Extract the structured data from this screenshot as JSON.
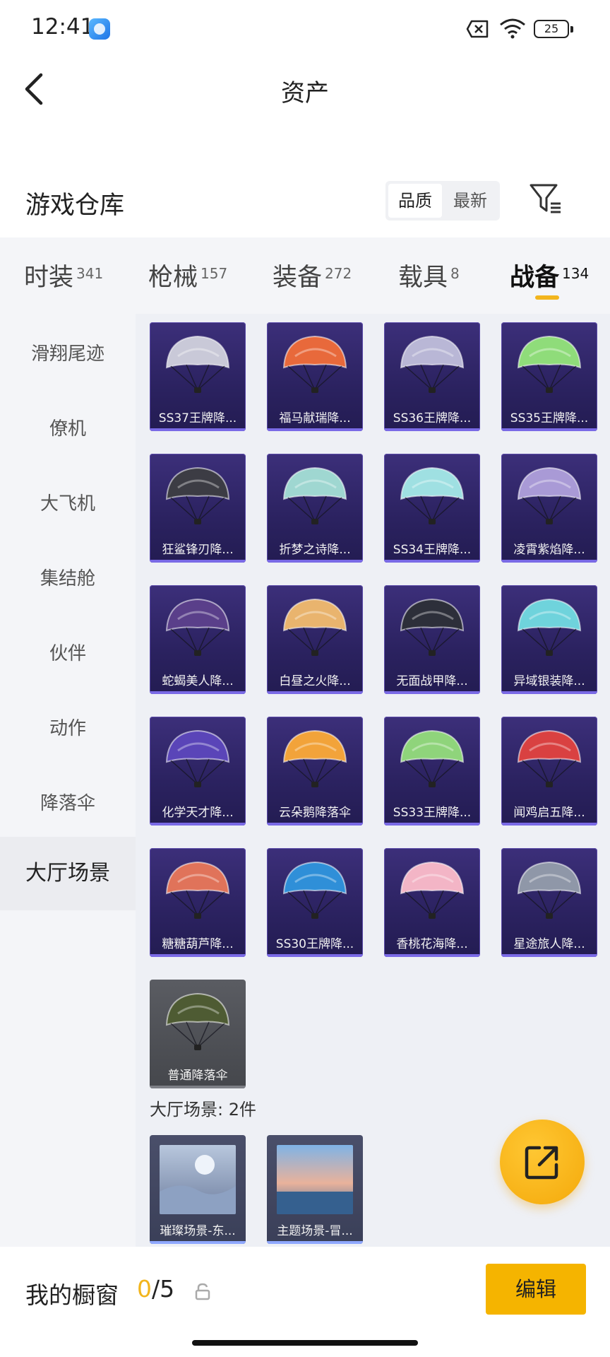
{
  "status_bar": {
    "time": "12:41",
    "battery": "25"
  },
  "nav": {
    "title": "资产"
  },
  "warehouse": {
    "title": "游戏仓库",
    "sort_options": [
      "品质",
      "最新"
    ],
    "active_sort": "品质"
  },
  "tabs": [
    {
      "label": "时装",
      "count": "341"
    },
    {
      "label": "枪械",
      "count": "157"
    },
    {
      "label": "装备",
      "count": "272"
    },
    {
      "label": "载具",
      "count": "8"
    },
    {
      "label": "战备",
      "count": "134",
      "active": true
    }
  ],
  "sidebar": {
    "items": [
      "滑翔尾迹",
      "僚机",
      "大飞机",
      "集结舱",
      "伙伴",
      "动作",
      "降落伞",
      "大厅场景"
    ],
    "active": "大厅场景"
  },
  "items": [
    {
      "name": "SS37王牌降...",
      "color": "#c9c9d8"
    },
    {
      "name": "福马献瑞降...",
      "color": "#e8693b"
    },
    {
      "name": "SS36王牌降...",
      "color": "#b9b7d6"
    },
    {
      "name": "SS35王牌降...",
      "color": "#8fdc7a"
    },
    {
      "name": "狂鲨锋刃降...",
      "color": "#3c3c44"
    },
    {
      "name": "折梦之诗降...",
      "color": "#9fd7d1"
    },
    {
      "name": "SS34王牌降...",
      "color": "#9fe0e2"
    },
    {
      "name": "凌霄紫焰降...",
      "color": "#a99ad6"
    },
    {
      "name": "蛇蝎美人降...",
      "color": "#5a3f8a"
    },
    {
      "name": "白昼之火降...",
      "color": "#e9b46e"
    },
    {
      "name": "无面战甲降...",
      "color": "#2d2f3a"
    },
    {
      "name": "异域银装降...",
      "color": "#6fd3dc"
    },
    {
      "name": "化学天才降...",
      "color": "#5a45b8"
    },
    {
      "name": "云朵鹅降落伞",
      "color": "#f2a33a"
    },
    {
      "name": "SS33王牌降...",
      "color": "#8fd47b"
    },
    {
      "name": "闻鸡启五降...",
      "color": "#d94141"
    },
    {
      "name": "糖糖葫芦降...",
      "color": "#e0735a"
    },
    {
      "name": "SS30王牌降...",
      "color": "#2f8fd8"
    },
    {
      "name": "香桃花海降...",
      "color": "#f3b5c6"
    },
    {
      "name": "星途旅人降...",
      "color": "#8f97a8"
    },
    {
      "name": "普通降落伞",
      "color": "#4e5b33",
      "grey": true
    }
  ],
  "scenes": {
    "label": "大厅场景: 2件",
    "items": [
      {
        "name": "璀璨场景-东..."
      },
      {
        "name": "主题场景-冒..."
      }
    ]
  },
  "bottom": {
    "label": "我的橱窗",
    "count_current": "0",
    "count_total": "/5",
    "edit_label": "编辑"
  }
}
